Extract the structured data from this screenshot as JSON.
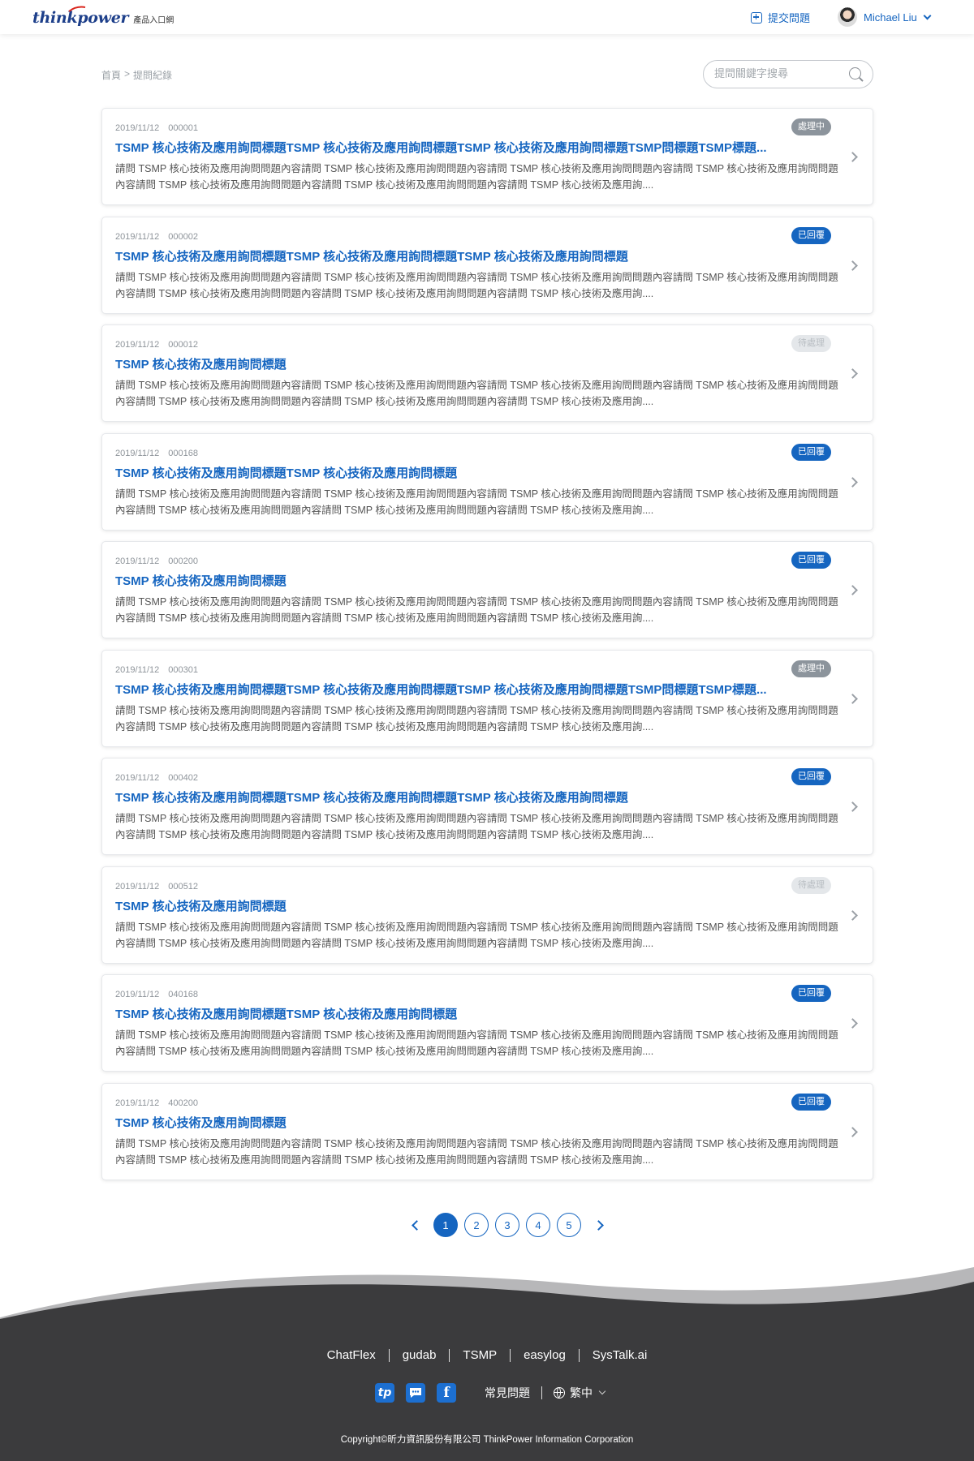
{
  "header": {
    "logo_text": "thinkpower",
    "logo_subtitle": "產品入口網",
    "submit_label": "提交問題",
    "user_name": "Michael Liu"
  },
  "breadcrumb": {
    "home": "首頁",
    "separator": ">",
    "current": "提問紀錄"
  },
  "search": {
    "placeholder": "提問關鍵字搜尋"
  },
  "status_colors": {
    "處理中": "#8c949c",
    "已回覆": "#1565c0",
    "待處理": "#e4e7ea"
  },
  "questions": [
    {
      "date": "2019/11/12",
      "id": "000001",
      "status": "處理中",
      "status_type": "processing",
      "title": "TSMP 核心技術及應用詢問標題TSMP 核心技術及應用詢問標題TSMP 核心技術及應用詢問標題TSMP問標題TSMP標題...",
      "body": "請問 TSMP 核心技術及應用詢問問題內容請問 TSMP 核心技術及應用詢問問題內容請問 TSMP 核心技術及應用詢問問題內容請問 TSMP 核心技術及應用詢問問題內容請問 TSMP 核心技術及應用詢問問題內容請問 TSMP 核心技術及應用詢問問題內容請問 TSMP 核心技術及應用詢...."
    },
    {
      "date": "2019/11/12",
      "id": "000002",
      "status": "已回覆",
      "status_type": "replied",
      "title": "TSMP 核心技術及應用詢問標題TSMP 核心技術及應用詢問標題TSMP 核心技術及應用詢問標題",
      "body": "請問 TSMP 核心技術及應用詢問問題內容請問 TSMP 核心技術及應用詢問問題內容請問 TSMP 核心技術及應用詢問問題內容請問 TSMP 核心技術及應用詢問問題內容請問 TSMP 核心技術及應用詢問問題內容請問 TSMP 核心技術及應用詢問問題內容請問 TSMP 核心技術及應用詢...."
    },
    {
      "date": "2019/11/12",
      "id": "000012",
      "status": "待處理",
      "status_type": "pending",
      "title": "TSMP 核心技術及應用詢問標題",
      "body": "請問 TSMP 核心技術及應用詢問問題內容請問 TSMP 核心技術及應用詢問問題內容請問 TSMP 核心技術及應用詢問問題內容請問 TSMP 核心技術及應用詢問問題內容請問 TSMP 核心技術及應用詢問問題內容請問 TSMP 核心技術及應用詢問問題內容請問 TSMP 核心技術及應用詢...."
    },
    {
      "date": "2019/11/12",
      "id": "000168",
      "status": "已回覆",
      "status_type": "replied",
      "title": "TSMP 核心技術及應用詢問標題TSMP 核心技術及應用詢問標題",
      "body": "請問 TSMP 核心技術及應用詢問問題內容請問 TSMP 核心技術及應用詢問問題內容請問 TSMP 核心技術及應用詢問問題內容請問 TSMP 核心技術及應用詢問問題內容請問 TSMP 核心技術及應用詢問問題內容請問 TSMP 核心技術及應用詢問問題內容請問 TSMP 核心技術及應用詢...."
    },
    {
      "date": "2019/11/12",
      "id": "000200",
      "status": "已回覆",
      "status_type": "replied",
      "title": "TSMP 核心技術及應用詢問標題",
      "body": "請問 TSMP 核心技術及應用詢問問題內容請問 TSMP 核心技術及應用詢問問題內容請問 TSMP 核心技術及應用詢問問題內容請問 TSMP 核心技術及應用詢問問題內容請問 TSMP 核心技術及應用詢問問題內容請問 TSMP 核心技術及應用詢問問題內容請問 TSMP 核心技術及應用詢...."
    },
    {
      "date": "2019/11/12",
      "id": "000301",
      "status": "處理中",
      "status_type": "processing",
      "title": "TSMP 核心技術及應用詢問標題TSMP 核心技術及應用詢問標題TSMP 核心技術及應用詢問標題TSMP問標題TSMP標題...",
      "body": "請問 TSMP 核心技術及應用詢問問題內容請問 TSMP 核心技術及應用詢問問題內容請問 TSMP 核心技術及應用詢問問題內容請問 TSMP 核心技術及應用詢問問題內容請問 TSMP 核心技術及應用詢問問題內容請問 TSMP 核心技術及應用詢問問題內容請問 TSMP 核心技術及應用詢...."
    },
    {
      "date": "2019/11/12",
      "id": "000402",
      "status": "已回覆",
      "status_type": "replied",
      "title": "TSMP 核心技術及應用詢問標題TSMP 核心技術及應用詢問標題TSMP 核心技術及應用詢問標題",
      "body": "請問 TSMP 核心技術及應用詢問問題內容請問 TSMP 核心技術及應用詢問問題內容請問 TSMP 核心技術及應用詢問問題內容請問 TSMP 核心技術及應用詢問問題內容請問 TSMP 核心技術及應用詢問問題內容請問 TSMP 核心技術及應用詢問問題內容請問 TSMP 核心技術及應用詢...."
    },
    {
      "date": "2019/11/12",
      "id": "000512",
      "status": "待處理",
      "status_type": "pending",
      "title": "TSMP 核心技術及應用詢問標題",
      "body": "請問 TSMP 核心技術及應用詢問問題內容請問 TSMP 核心技術及應用詢問問題內容請問 TSMP 核心技術及應用詢問問題內容請問 TSMP 核心技術及應用詢問問題內容請問 TSMP 核心技術及應用詢問問題內容請問 TSMP 核心技術及應用詢問問題內容請問 TSMP 核心技術及應用詢...."
    },
    {
      "date": "2019/11/12",
      "id": "040168",
      "status": "已回覆",
      "status_type": "replied",
      "title": "TSMP 核心技術及應用詢問標題TSMP 核心技術及應用詢問標題",
      "body": "請問 TSMP 核心技術及應用詢問問題內容請問 TSMP 核心技術及應用詢問問題內容請問 TSMP 核心技術及應用詢問問題內容請問 TSMP 核心技術及應用詢問問題內容請問 TSMP 核心技術及應用詢問問題內容請問 TSMP 核心技術及應用詢問問題內容請問 TSMP 核心技術及應用詢...."
    },
    {
      "date": "2019/11/12",
      "id": "400200",
      "status": "已回覆",
      "status_type": "replied",
      "title": "TSMP 核心技術及應用詢問標題",
      "body": "請問 TSMP 核心技術及應用詢問問題內容請問 TSMP 核心技術及應用詢問問題內容請問 TSMP 核心技術及應用詢問問題內容請問 TSMP 核心技術及應用詢問問題內容請問 TSMP 核心技術及應用詢問問題內容請問 TSMP 核心技術及應用詢問問題內容請問 TSMP 核心技術及應用詢...."
    }
  ],
  "pagination": {
    "pages": [
      "1",
      "2",
      "3",
      "4",
      "5"
    ],
    "current": "1"
  },
  "footer": {
    "links": [
      "ChatFlex",
      "gudab",
      "TSMP",
      "easylog",
      "SysTalk.ai"
    ],
    "social_icons": [
      "tp-icon",
      "chat-icon",
      "facebook-icon"
    ],
    "tp_glyph": "tp",
    "fb_glyph": "f",
    "faq_label": "常見問題",
    "language": "繁中",
    "copyright": "Copyright©昕力資訊股份有限公司 ThinkPower Information Corporation",
    "background_color": "#3b3b3d"
  }
}
